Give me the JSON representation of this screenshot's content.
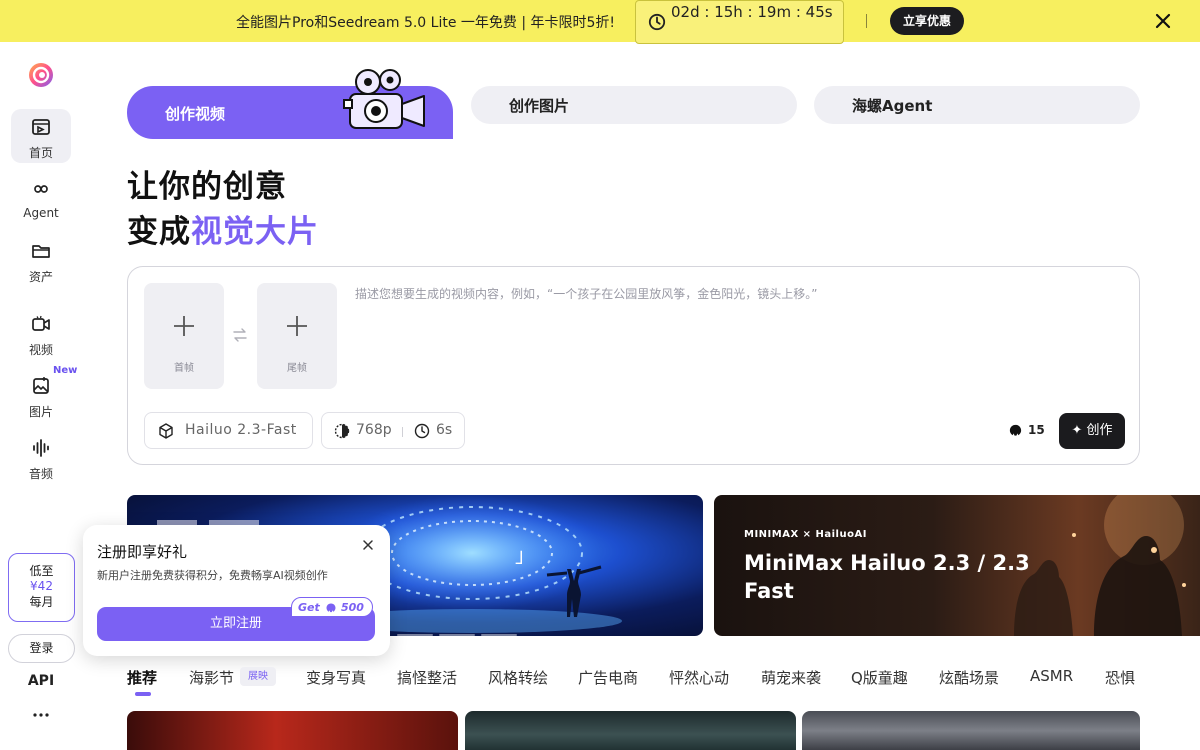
{
  "promo": {
    "text": "全能图片Pro和Seedream 5.0 Lite 一年免费 | 年卡限时5折!",
    "countdown": "02d : 15h : 19m : 45s",
    "cta": "立享优惠"
  },
  "sidebar": {
    "items": [
      {
        "label": "首页"
      },
      {
        "label": "Agent"
      },
      {
        "label": "资产"
      },
      {
        "label": "视频"
      },
      {
        "label": "图片"
      },
      {
        "label": "音频"
      }
    ],
    "new_tag": "New",
    "price": {
      "line1": "低至",
      "line2": "¥42",
      "line3": "每月"
    },
    "login": "登录",
    "api": "API"
  },
  "main_tabs": [
    {
      "label": "创作视频"
    },
    {
      "label": "创作图片"
    },
    {
      "label": "海螺Agent"
    }
  ],
  "headline": {
    "line1": "让你的创意",
    "line2_prefix": "变成",
    "line2_accent": "视觉大片"
  },
  "prompt": {
    "first_frame": "首帧",
    "last_frame": "尾帧",
    "placeholder": "描述您想要生成的视频内容，例如，“一个孩子在公园里放风筝，金色阳光，镜头上移。”",
    "model": "Hailuo 2.3-Fast",
    "resolution": "768p",
    "duration": "6s",
    "credits": "15",
    "create": "创作"
  },
  "banners": {
    "b1_quote": "」",
    "b2_brand": "MINIMAX × HailuoAI",
    "b2_title": "MiniMax Hailuo 2.3 / 2.3 Fast"
  },
  "popup": {
    "title": "注册即享好礼",
    "desc": "新用户注册免费获得积分，免费畅享AI视频创作",
    "cta": "立即注册",
    "badge_get": "Get",
    "badge_num": "500"
  },
  "categories": [
    {
      "label": "推荐"
    },
    {
      "label": "海影节",
      "badge": "展映"
    },
    {
      "label": "变身写真"
    },
    {
      "label": "搞怪整活"
    },
    {
      "label": "风格转绘"
    },
    {
      "label": "广告电商"
    },
    {
      "label": "怦然心动"
    },
    {
      "label": "萌宠来袭"
    },
    {
      "label": "Q版童趣"
    },
    {
      "label": "炫酷场景"
    },
    {
      "label": "ASMR"
    },
    {
      "label": "恐惧"
    }
  ],
  "colors": {
    "accent": "#7b61f3",
    "promo_bg": "#f7ef5f",
    "dark": "#1b1b1e"
  }
}
